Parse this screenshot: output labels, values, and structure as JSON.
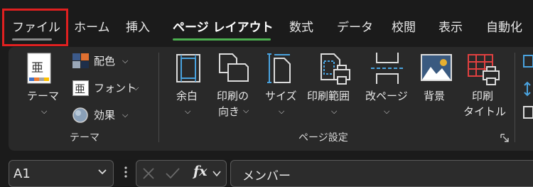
{
  "tabs": [
    {
      "label": "ファイル",
      "active": false
    },
    {
      "label": "ホーム",
      "active": false
    },
    {
      "label": "挿入",
      "active": false
    },
    {
      "label": "ページ レイアウト",
      "active": true
    },
    {
      "label": "数式",
      "active": false
    },
    {
      "label": "データ",
      "active": false
    },
    {
      "label": "校閲",
      "active": false
    },
    {
      "label": "表示",
      "active": false
    },
    {
      "label": "自動化",
      "active": false
    }
  ],
  "colors": {
    "active_tab_underline": "#4caf50",
    "file_tab_underline": "#8a8a8a",
    "highlight_box": "#e02020",
    "icon_blue": "#4aa3df"
  },
  "groups": {
    "theme": {
      "label": "テーマ",
      "themes_button": {
        "label": "テーマ",
        "icon": "theme-icon",
        "icon_text": "亜"
      },
      "colors_button": {
        "label": "配色",
        "icon": "color-palette-icon"
      },
      "fonts_button": {
        "label": "フォント",
        "icon": "font-icon",
        "icon_text": "亜"
      },
      "effects_button": {
        "label": "効果",
        "icon": "effects-icon"
      }
    },
    "page_setup": {
      "label": "ページ設定",
      "buttons": [
        {
          "label": "余白",
          "icon": "margins-icon"
        },
        {
          "label": "印刷の",
          "label2": "向き",
          "icon": "orientation-icon"
        },
        {
          "label": "サイズ",
          "icon": "size-icon"
        },
        {
          "label": "印刷範囲",
          "icon": "print-area-icon"
        },
        {
          "label": "改ページ",
          "icon": "page-break-icon"
        },
        {
          "label": "背景",
          "icon": "background-icon"
        },
        {
          "label": "印刷",
          "label2": "タイトル",
          "icon": "print-titles-icon"
        }
      ]
    }
  },
  "formula_bar": {
    "name_box": "A1",
    "fx_label": "fx",
    "formula_value": "メンバー"
  }
}
